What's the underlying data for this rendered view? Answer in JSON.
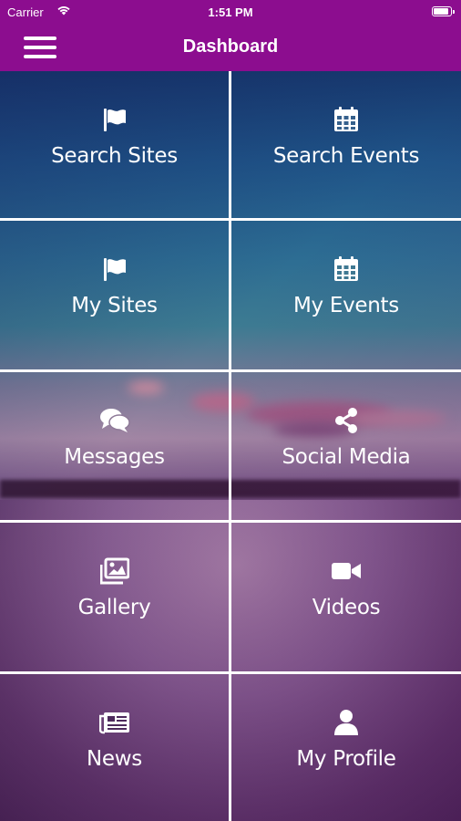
{
  "status_bar": {
    "carrier": "Carrier",
    "time": "1:51 PM"
  },
  "header": {
    "title": "Dashboard",
    "menu_icon": "hamburger-menu-icon"
  },
  "tiles": [
    {
      "label": "Search Sites",
      "icon": "flag-icon"
    },
    {
      "label": "Search Events",
      "icon": "calendar-icon"
    },
    {
      "label": "My Sites",
      "icon": "flag-icon"
    },
    {
      "label": "My Events",
      "icon": "calendar-icon"
    },
    {
      "label": "Messages",
      "icon": "chat-bubbles-icon"
    },
    {
      "label": "Social Media",
      "icon": "share-icon"
    },
    {
      "label": "Gallery",
      "icon": "images-icon"
    },
    {
      "label": "Videos",
      "icon": "video-camera-icon"
    },
    {
      "label": "News",
      "icon": "newspaper-icon"
    },
    {
      "label": "My Profile",
      "icon": "user-icon"
    }
  ],
  "colors": {
    "header_bg": "#8c0d8f",
    "text": "#ffffff",
    "grid_lines": "#ffffff"
  }
}
